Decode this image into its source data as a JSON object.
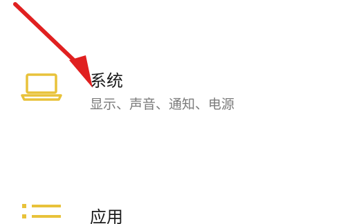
{
  "settings": {
    "items": [
      {
        "title": "系统",
        "description": "显示、声音、通知、电源",
        "icon": "laptop-icon",
        "icon_color": "#e8c23a"
      },
      {
        "title": "应用",
        "icon": "apps-list-icon",
        "icon_color": "#e8c23a"
      }
    ]
  },
  "annotation": {
    "icon": "red-arrow-icon",
    "color": "#e02020"
  }
}
